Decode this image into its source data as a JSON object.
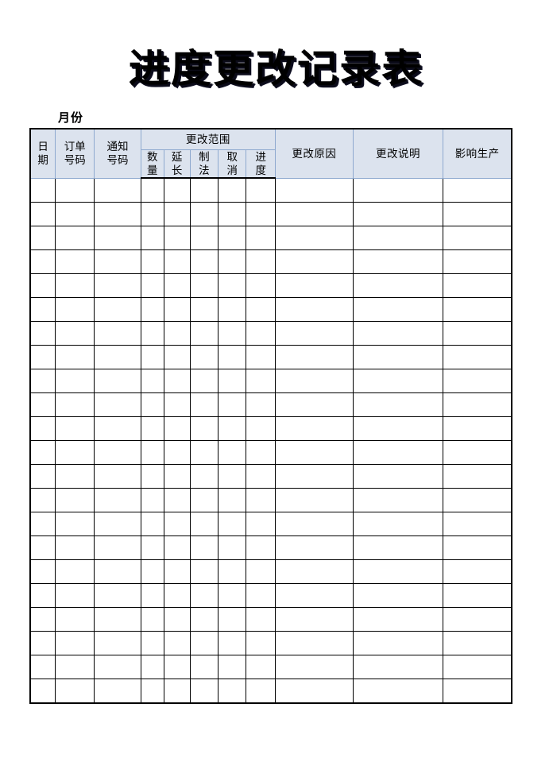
{
  "document": {
    "title": "进度更改记录表",
    "month_label": "月份"
  },
  "table": {
    "group_header": "更改范围",
    "columns": [
      {
        "key": "date",
        "label": "日期",
        "stacked": "日\n期"
      },
      {
        "key": "order_no",
        "label": "订单号码",
        "stacked": "订单\n号码"
      },
      {
        "key": "notice_no",
        "label": "通知号码",
        "stacked": "通知\n号码"
      },
      {
        "key": "quantity",
        "label": "数量",
        "stacked": "数\n量"
      },
      {
        "key": "extend",
        "label": "延长",
        "stacked": "延\n长"
      },
      {
        "key": "method",
        "label": "制法",
        "stacked": "制\n法"
      },
      {
        "key": "cancel",
        "label": "取消",
        "stacked": "取\n消"
      },
      {
        "key": "progress",
        "label": "进度",
        "stacked": "进\n度"
      },
      {
        "key": "reason",
        "label": "更改原因",
        "stacked": "更改原因"
      },
      {
        "key": "note",
        "label": "更改说明",
        "stacked": "更改说明"
      },
      {
        "key": "impact",
        "label": "影响生产",
        "stacked": "影响生产"
      }
    ],
    "header_cells": {
      "date_l1": "日",
      "date_l2": "期",
      "order_l1": "订单",
      "order_l2": "号码",
      "notice_l1": "通知",
      "notice_l2": "号码",
      "qty_l1": "数",
      "qty_l2": "量",
      "ext_l1": "延",
      "ext_l2": "长",
      "method_l1": "制",
      "method_l2": "法",
      "cancel_l1": "取",
      "cancel_l2": "消",
      "prog_l1": "进",
      "prog_l2": "度",
      "reason": "更改原因",
      "note": "更改说明",
      "impact": "影响生产"
    },
    "body_row_count": 22,
    "body_rows": [
      [
        "",
        "",
        "",
        "",
        "",
        "",
        "",
        "",
        "",
        "",
        ""
      ],
      [
        "",
        "",
        "",
        "",
        "",
        "",
        "",
        "",
        "",
        "",
        ""
      ],
      [
        "",
        "",
        "",
        "",
        "",
        "",
        "",
        "",
        "",
        "",
        ""
      ],
      [
        "",
        "",
        "",
        "",
        "",
        "",
        "",
        "",
        "",
        "",
        ""
      ],
      [
        "",
        "",
        "",
        "",
        "",
        "",
        "",
        "",
        "",
        "",
        ""
      ],
      [
        "",
        "",
        "",
        "",
        "",
        "",
        "",
        "",
        "",
        "",
        ""
      ],
      [
        "",
        "",
        "",
        "",
        "",
        "",
        "",
        "",
        "",
        "",
        ""
      ],
      [
        "",
        "",
        "",
        "",
        "",
        "",
        "",
        "",
        "",
        "",
        ""
      ],
      [
        "",
        "",
        "",
        "",
        "",
        "",
        "",
        "",
        "",
        "",
        ""
      ],
      [
        "",
        "",
        "",
        "",
        "",
        "",
        "",
        "",
        "",
        "",
        ""
      ],
      [
        "",
        "",
        "",
        "",
        "",
        "",
        "",
        "",
        "",
        "",
        ""
      ],
      [
        "",
        "",
        "",
        "",
        "",
        "",
        "",
        "",
        "",
        "",
        ""
      ],
      [
        "",
        "",
        "",
        "",
        "",
        "",
        "",
        "",
        "",
        "",
        ""
      ],
      [
        "",
        "",
        "",
        "",
        "",
        "",
        "",
        "",
        "",
        "",
        ""
      ],
      [
        "",
        "",
        "",
        "",
        "",
        "",
        "",
        "",
        "",
        "",
        ""
      ],
      [
        "",
        "",
        "",
        "",
        "",
        "",
        "",
        "",
        "",
        "",
        ""
      ],
      [
        "",
        "",
        "",
        "",
        "",
        "",
        "",
        "",
        "",
        "",
        ""
      ],
      [
        "",
        "",
        "",
        "",
        "",
        "",
        "",
        "",
        "",
        "",
        ""
      ],
      [
        "",
        "",
        "",
        "",
        "",
        "",
        "",
        "",
        "",
        "",
        ""
      ],
      [
        "",
        "",
        "",
        "",
        "",
        "",
        "",
        "",
        "",
        "",
        ""
      ],
      [
        "",
        "",
        "",
        "",
        "",
        "",
        "",
        "",
        "",
        "",
        ""
      ],
      [
        "",
        "",
        "",
        "",
        "",
        "",
        "",
        "",
        "",
        "",
        ""
      ]
    ]
  },
  "colors": {
    "header_fill": "#dce3ee",
    "header_border": "#8ea9cf",
    "grid_border": "#000000",
    "page_background": "#ffffff",
    "text": "#000000"
  }
}
